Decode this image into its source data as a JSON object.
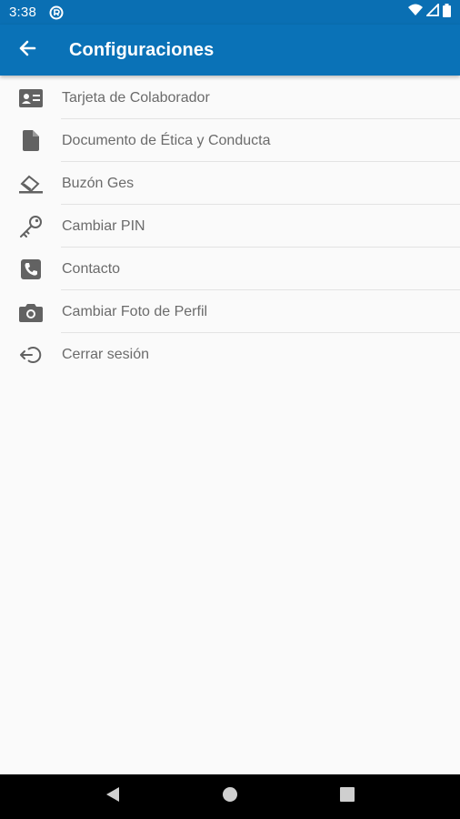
{
  "status_bar": {
    "time": "3:38",
    "icons": [
      "notification-badge-icon",
      "wifi-icon",
      "signal-icon",
      "battery-icon"
    ]
  },
  "header": {
    "title": "Configuraciones",
    "back_icon": "arrow-left-icon",
    "background_color": "#0a72b7"
  },
  "menu": {
    "items": [
      {
        "label": "Tarjeta de Colaborador",
        "icon": "id-card-icon"
      },
      {
        "label": "Documento de Ética y Conducta",
        "icon": "document-icon"
      },
      {
        "label": "Buzón Ges",
        "icon": "mailbox-icon"
      },
      {
        "label": "Cambiar PIN",
        "icon": "key-icon"
      },
      {
        "label": "Contacto",
        "icon": "phone-icon"
      },
      {
        "label": "Cambiar Foto de Perfil",
        "icon": "camera-icon"
      },
      {
        "label": "Cerrar sesión",
        "icon": "logout-icon"
      }
    ]
  },
  "navigation_bar": {
    "buttons": [
      "back-triangle-icon",
      "home-circle-icon",
      "recents-square-icon"
    ]
  }
}
